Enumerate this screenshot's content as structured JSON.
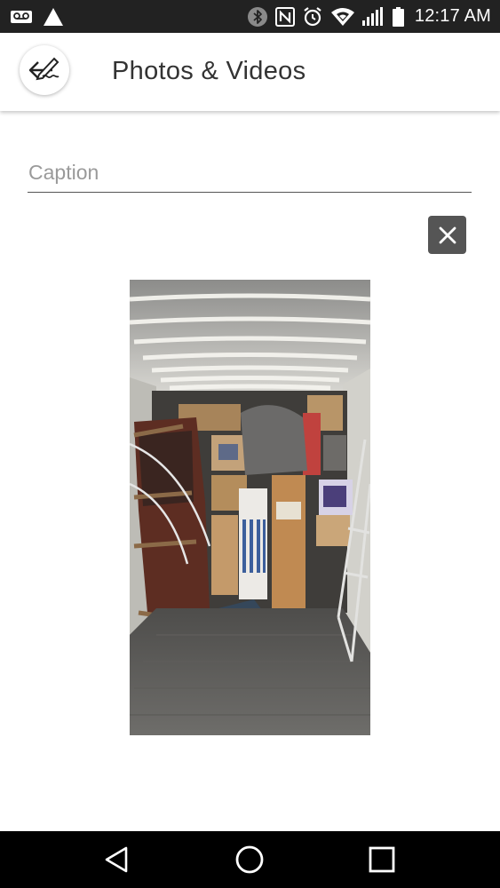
{
  "status_bar": {
    "time": "12:17 AM",
    "left_icons": [
      "voicemail-icon",
      "warning-icon"
    ],
    "right_icons": [
      "bluetooth-icon",
      "nfc-icon",
      "alarm-icon",
      "wifi-icon",
      "cell-signal-icon",
      "battery-icon"
    ]
  },
  "app_bar": {
    "title": "Photos & Videos",
    "back_icon": "edit-back-icon"
  },
  "caption": {
    "placeholder": "Caption",
    "value": ""
  },
  "photo": {
    "remove_icon": "close-icon",
    "subject": "moving-truck-interior"
  },
  "nav_bar": {
    "buttons": [
      "back-nav-icon",
      "home-nav-icon",
      "recents-nav-icon"
    ]
  },
  "colors": {
    "status_bar_bg": "#222222",
    "nav_bar_bg": "#000000",
    "title_text": "#333333",
    "remove_button_bg": "#555555",
    "placeholder_text": "#9a9a9a"
  }
}
